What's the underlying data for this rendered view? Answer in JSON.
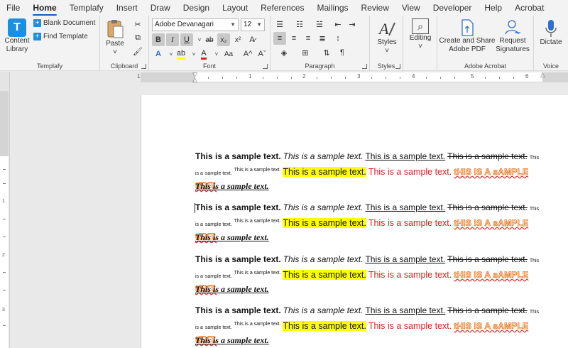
{
  "menu": {
    "tabs": [
      "File",
      "Home",
      "Templafy",
      "Insert",
      "Draw",
      "Design",
      "Layout",
      "References",
      "Mailings",
      "Review",
      "View",
      "Developer",
      "Help",
      "Acrobat"
    ],
    "active": "Home"
  },
  "ribbon": {
    "templafy": {
      "content_library": "Content",
      "content_library_2": "Library",
      "blank_document": "Blank Document",
      "find_template": "Find Template",
      "group_label": "Templafy"
    },
    "clipboard": {
      "paste": "Paste",
      "group_label": "Clipboard"
    },
    "font": {
      "font_name": "Adobe Devanagari",
      "font_size": "12",
      "bold": "B",
      "italic": "I",
      "underline": "U",
      "strike": "ab",
      "subscript": "x₂",
      "superscript": "x²",
      "case": "Aa",
      "grow": "A^",
      "shrink": "Aˇ",
      "group_label": "Font"
    },
    "paragraph": {
      "group_label": "Paragraph"
    },
    "styles": {
      "styles": "Styles",
      "group_label": "Styles"
    },
    "editing": {
      "editing": "Editing"
    },
    "acrobat": {
      "create_share": "Create and Share",
      "create_share_2": "Adobe PDF",
      "request": "Request",
      "request_2": "Signatures",
      "group_label": "Adobe Acrobat"
    },
    "voice": {
      "dictate": "Dictate",
      "group_label": "Voice"
    }
  },
  "ruler": {
    "h_numbers": [
      "1",
      "1",
      "2",
      "3",
      "4",
      "5",
      "6"
    ],
    "v_numbers": [
      "1",
      "2",
      "3"
    ]
  },
  "document": {
    "blocks": [
      {
        "bold": "This is a sample text.",
        "italic": "This is a sample text.",
        "underline": "This is a sample text.",
        "strike": "This is a sample text.",
        "small": "This is a",
        "small_2": "sample text.",
        "superscript": "This is a sample text.",
        "highlight": "This is a sample text.",
        "red": "This is a sample text.",
        "effect": "tHIS IS A sAMPLE tEXT.",
        "heading": "This is a sample text."
      },
      {
        "bold": "This is a sample text.",
        "italic": "This is a sample text.",
        "underline": "This is a sample text.",
        "strike": "This is a sample text.",
        "small": "This is a",
        "small_2": "sample text.",
        "superscript": "This is a sample text.",
        "highlight": "This is a sample text.",
        "red": "This is a sample text.",
        "effect": "tHIS IS A sAMPLE tEXT.",
        "heading": "This is a sample text."
      },
      {
        "bold": "This is a sample text.",
        "italic": "This is a sample text.",
        "underline": "This is a sample text.",
        "strike": "This is a sample text.",
        "small": "This is a",
        "small_2": "sample text.",
        "superscript": "This is a sample text.",
        "highlight": "This is a sample text.",
        "red": "This is a sample text.",
        "effect": "tHIS IS A sAMPLE tEXT.",
        "heading": "This is a sample text."
      },
      {
        "bold": "This is a sample text.",
        "italic": "This is a sample text.",
        "underline": "This is a sample text.",
        "strike": "This is a sample text.",
        "small": "This is a",
        "small_2": "sample text.",
        "superscript": "This is a sample text.",
        "highlight": "This is a sample text.",
        "red": "This is a sample text.",
        "effect": "tHIS IS A sAMPLE tEXT.",
        "heading": "This is a sample text."
      }
    ]
  },
  "colors": {
    "accent": "#185abd",
    "highlight": "#ffff00",
    "red_text": "#e02020",
    "effect_outline": "#e8731e"
  }
}
